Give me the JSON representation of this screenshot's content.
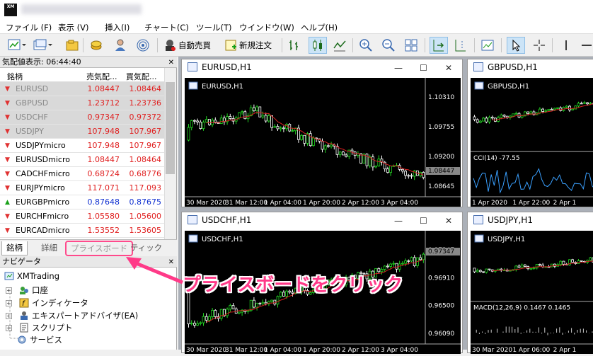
{
  "app": {
    "logo_text": "XM"
  },
  "menu": [
    "ファイル (F)",
    "表示 (V)",
    "挿入(I)",
    "チャート(C)",
    "ツール(T)",
    "ウインドウ(W)",
    "ヘルプ(H)"
  ],
  "toolbar": {
    "auto_trade": "自動売買",
    "new_order": "新規注文"
  },
  "market_watch": {
    "title": "気配値表示: 06:44:40",
    "columns": {
      "symbol": "銘柄",
      "bid": "売気配...",
      "ask": "買気配..."
    },
    "rows": [
      {
        "symbol": "EURUSD",
        "bid": "1.08447",
        "ask": "1.08464",
        "dir": "down",
        "symcolor": "gray",
        "pcolor": "red"
      },
      {
        "symbol": "GBPUSD",
        "bid": "1.23712",
        "ask": "1.23736",
        "dir": "down",
        "symcolor": "gray",
        "pcolor": "red"
      },
      {
        "symbol": "USDCHF",
        "bid": "0.97347",
        "ask": "0.97372",
        "dir": "down",
        "symcolor": "gray",
        "pcolor": "red"
      },
      {
        "symbol": "USDJPY",
        "bid": "107.948",
        "ask": "107.967",
        "dir": "down",
        "symcolor": "gray",
        "pcolor": "red"
      },
      {
        "symbol": "USDJPYmicro",
        "bid": "107.948",
        "ask": "107.967",
        "dir": "down",
        "symcolor": "black",
        "pcolor": "red"
      },
      {
        "symbol": "EURUSDmicro",
        "bid": "1.08447",
        "ask": "1.08464",
        "dir": "down",
        "symcolor": "black",
        "pcolor": "red"
      },
      {
        "symbol": "CADCHFmicro",
        "bid": "0.68724",
        "ask": "0.68776",
        "dir": "down",
        "symcolor": "black",
        "pcolor": "red"
      },
      {
        "symbol": "EURJPYmicro",
        "bid": "117.071",
        "ask": "117.093",
        "dir": "down",
        "symcolor": "black",
        "pcolor": "red"
      },
      {
        "symbol": "EURGBPmicro",
        "bid": "0.87648",
        "ask": "0.87675",
        "dir": "up",
        "symcolor": "black",
        "pcolor": "blue"
      },
      {
        "symbol": "EURCHFmicro",
        "bid": "1.05580",
        "ask": "1.05600",
        "dir": "down",
        "symcolor": "black",
        "pcolor": "red"
      },
      {
        "symbol": "EURCADmicro",
        "bid": "1.53552",
        "ask": "1.53605",
        "dir": "down",
        "symcolor": "black",
        "pcolor": "red"
      }
    ],
    "tabs": [
      "銘柄",
      "詳細",
      "プライスボード",
      "ティック"
    ]
  },
  "navigator": {
    "title": "ナビゲータ",
    "root": "XMTrading",
    "items": [
      "口座",
      "インディケータ",
      "エキスパートアドバイザ(EA)",
      "スクリプト",
      "サービス"
    ]
  },
  "charts": [
    {
      "window_title": "EURUSD,H1",
      "label": "EURUSD,H1",
      "prices": [
        "1.10310",
        "1.09755",
        "1.09200",
        "1.08645"
      ],
      "current": "1.08447",
      "dates": [
        "30 Mar 2020",
        "31 Mar 12:00",
        "1 Apr 04:00",
        "1 Apr 20:00",
        "2 Apr 12:00",
        "3 Apr 04:00"
      ]
    },
    {
      "window_title": "GBPUSD,H1",
      "label": "GBPUSD,H1",
      "indicator": "CCI(14) -77.55",
      "dates": [
        "1 Apr 2020",
        "1 Apr 22:00",
        "2 Apr 1"
      ]
    },
    {
      "window_title": "USDCHF,H1",
      "label": "USDCHF,H1",
      "prices": [
        "0.97347",
        "0.96910",
        "0.96500",
        "0.96090"
      ],
      "current": "0.97347",
      "dates": [
        "30 Mar 2020",
        "31 Mar 12:00",
        "1 Apr 04:00",
        "1 Apr 20:00",
        "2 Apr 12:00",
        "3 Apr 04:00"
      ]
    },
    {
      "window_title": "USDJPY,H1",
      "label": "USDJPY,H1",
      "indicator": "MACD(12,26,9) 0.1467 0.1465",
      "dates": [
        "30 Mar 2020",
        "1 Apr 06:00",
        "2 Apr 1"
      ]
    }
  ],
  "callout": "プライスボードをクリック",
  "colors": {
    "accent": "#ff3a88",
    "bull": "#22d822",
    "bear": "#ffffff",
    "ma": "#d42020"
  }
}
